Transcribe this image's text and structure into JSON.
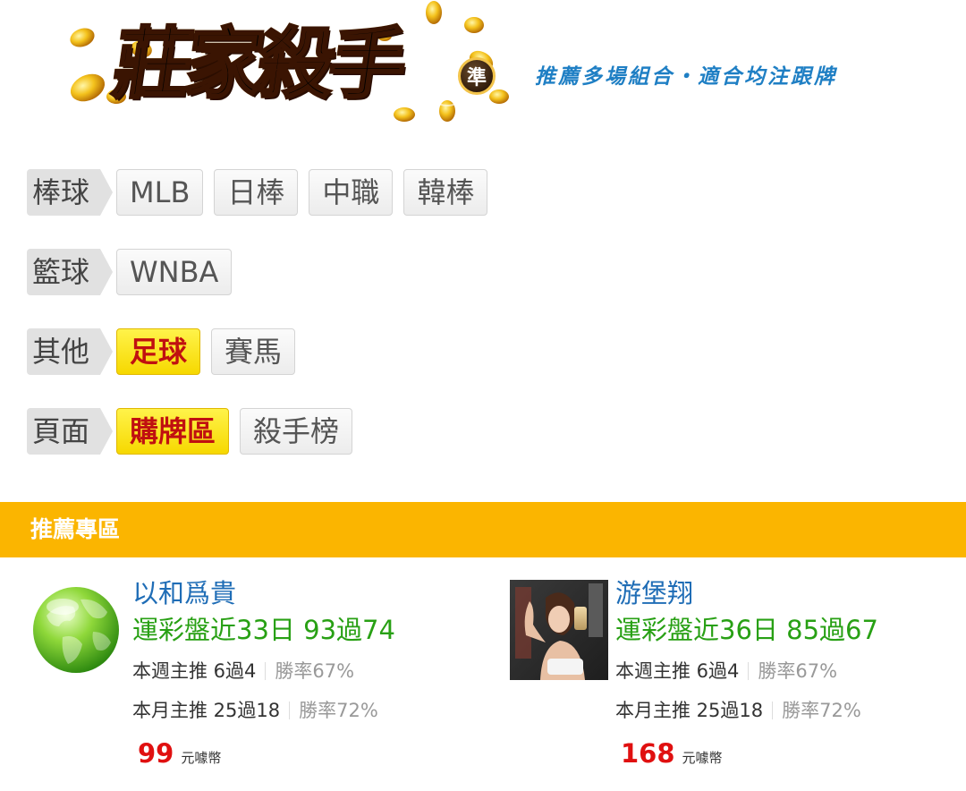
{
  "header": {
    "logo_text": "莊家殺手",
    "logo_badge": "準",
    "tagline": "推薦多場組合・適合均注跟牌"
  },
  "categories": [
    {
      "label": "棒球",
      "tags": [
        {
          "text": "MLB",
          "active": false
        },
        {
          "text": "日棒",
          "active": false
        },
        {
          "text": "中職",
          "active": false
        },
        {
          "text": "韓棒",
          "active": false
        }
      ]
    },
    {
      "label": "籃球",
      "tags": [
        {
          "text": "WNBA",
          "active": false
        }
      ]
    },
    {
      "label": "其他",
      "tags": [
        {
          "text": "足球",
          "active": true
        },
        {
          "text": "賽馬",
          "active": false
        }
      ]
    },
    {
      "label": "頁面",
      "tags": [
        {
          "text": "購牌區",
          "active": true
        },
        {
          "text": "殺手榜",
          "active": false
        }
      ]
    }
  ],
  "section": {
    "title": "推薦專區"
  },
  "cards": [
    {
      "name": "以和爲貴",
      "record": "運彩盤近33日 93過74",
      "weekly": "本週主推 6過4",
      "weekly_rate": "勝率67%",
      "monthly": "本月主推 25過18",
      "monthly_rate": "勝率72%",
      "price": "99",
      "unit": "元噱幣",
      "avatar": "globe-avatar"
    },
    {
      "name": "游堡翔",
      "record": "運彩盤近36日 85過67",
      "weekly": "本週主推 6過4",
      "weekly_rate": "勝率67%",
      "monthly": "本月主推 25過18",
      "monthly_rate": "勝率72%",
      "price": "168",
      "unit": "元噱幣",
      "avatar": "photo-avatar"
    }
  ],
  "colors": {
    "section_bar": "#fbb500",
    "name": "#1f6db6",
    "record": "#28a014",
    "price": "#e01010",
    "active_tag": "#f6d800",
    "tagline": "#1f7fc4"
  }
}
